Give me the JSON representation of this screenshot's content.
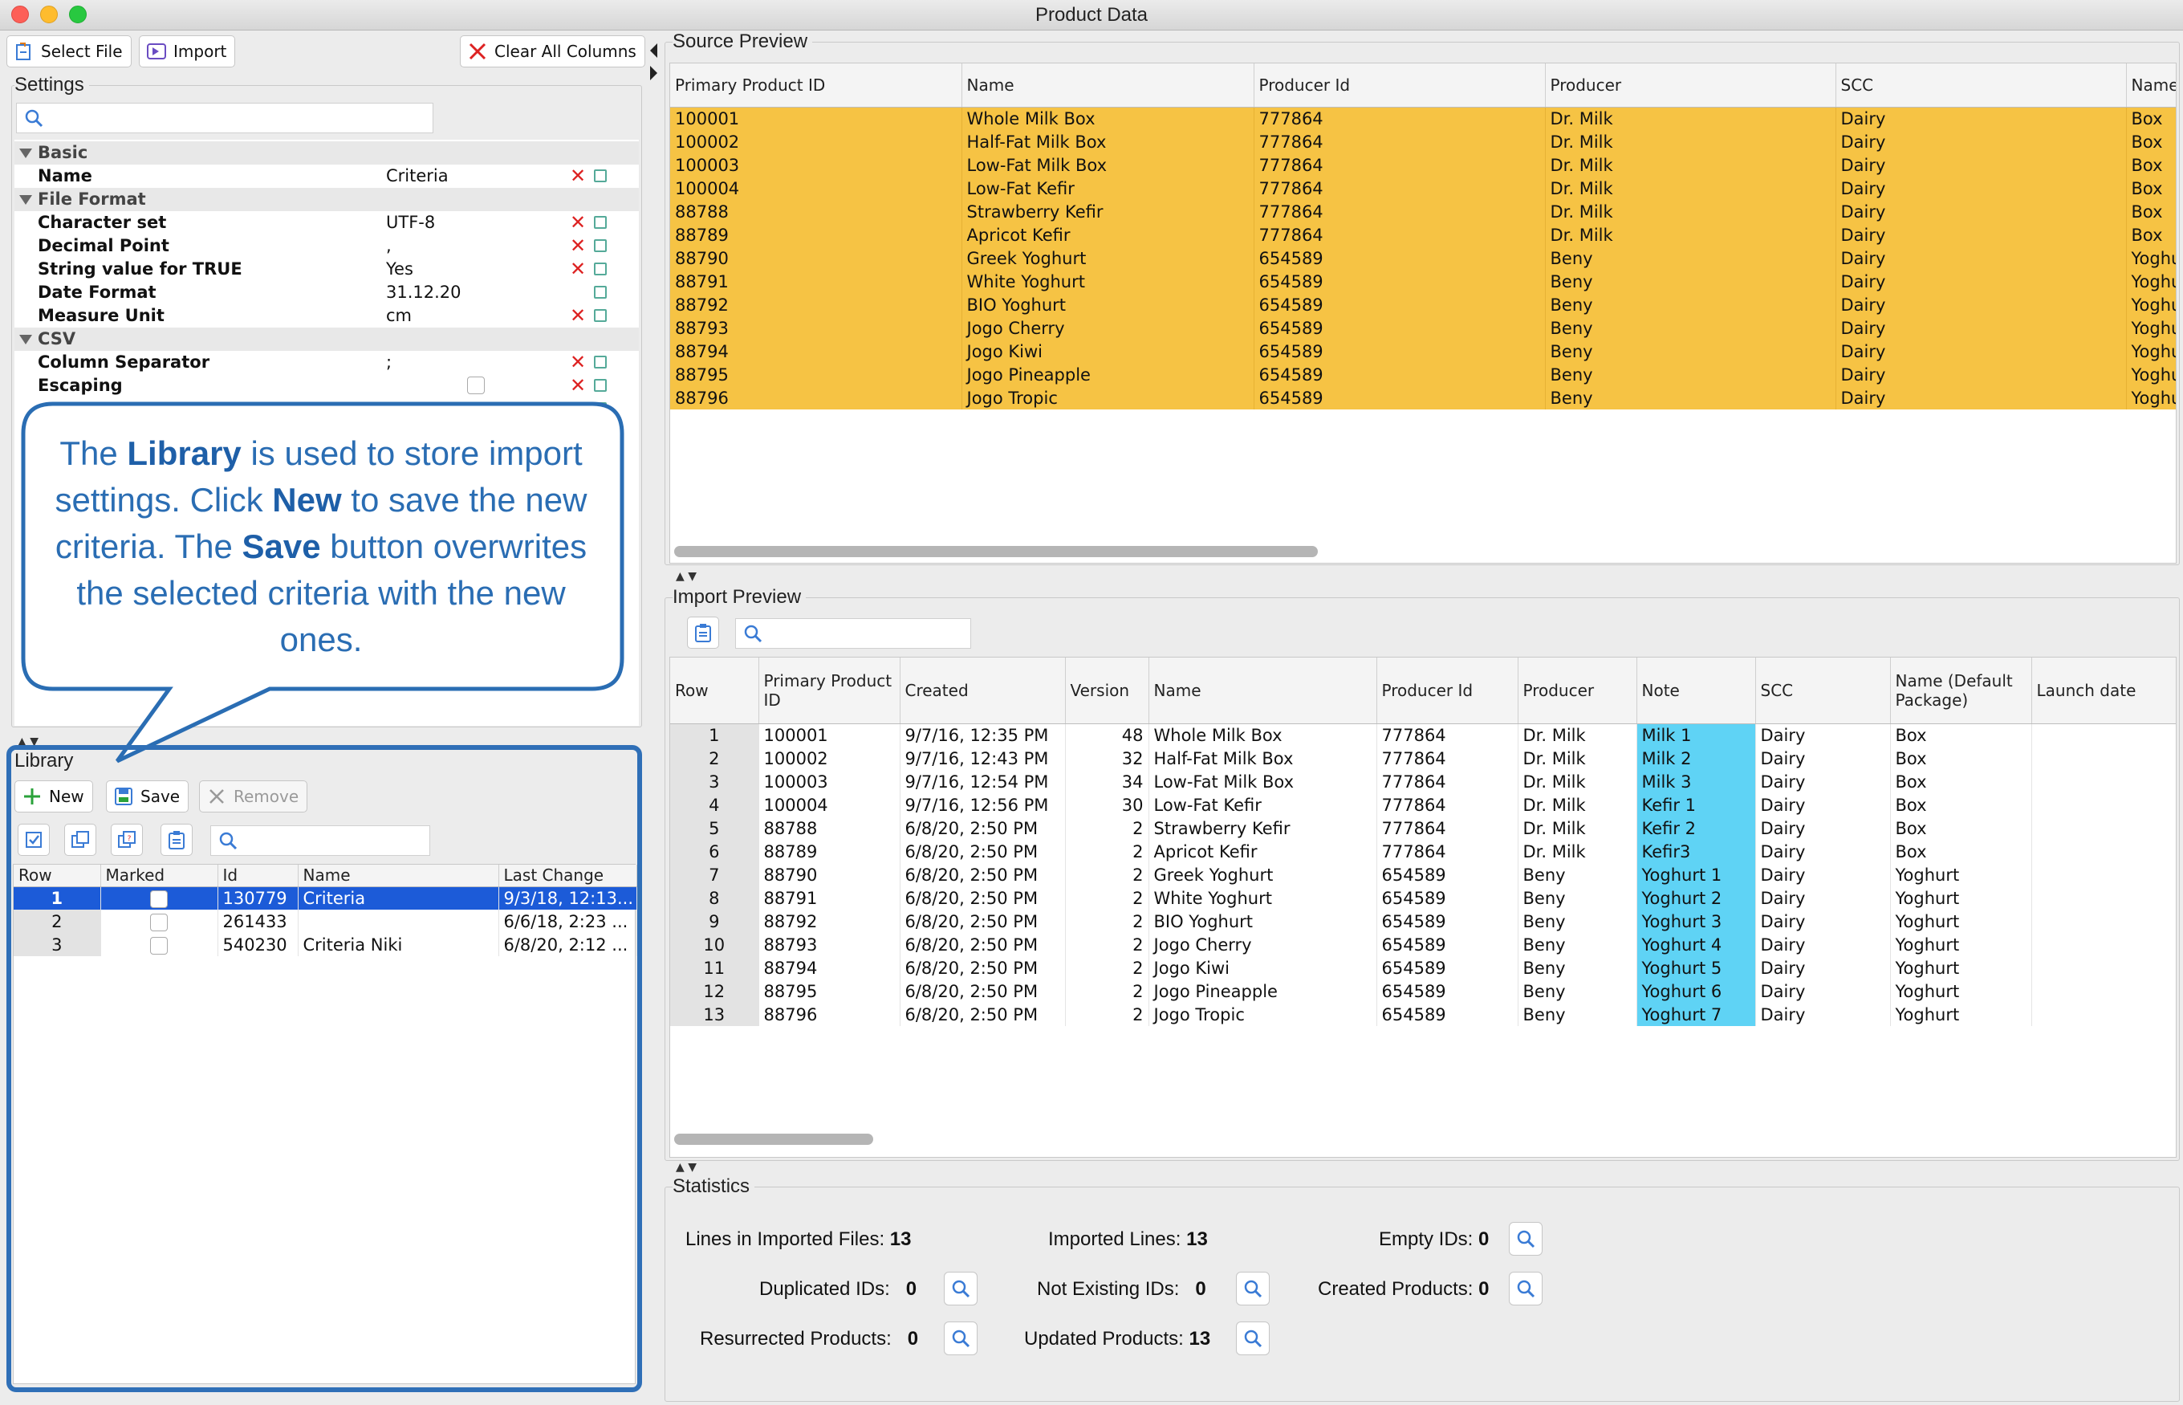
{
  "window": {
    "title": "Product Data"
  },
  "toolbar": {
    "select_file": "Select File",
    "import": "Import",
    "clear_all_columns": "Clear All Columns"
  },
  "settings": {
    "title": "Settings",
    "groups": {
      "basic": "Basic",
      "file_format": "File Format",
      "csv": "CSV"
    },
    "rows": {
      "name": {
        "label": "Name",
        "value": "Criteria"
      },
      "charset": {
        "label": "Character set",
        "value": "UTF-8"
      },
      "decimal": {
        "label": "Decimal Point",
        "value": ","
      },
      "true_string": {
        "label": "String value for TRUE",
        "value": "Yes"
      },
      "date_format": {
        "label": "Date Format",
        "value": "31.12.20"
      },
      "measure_unit": {
        "label": "Measure Unit",
        "value": "cm"
      },
      "col_sep": {
        "label": "Column Separator",
        "value": ";"
      },
      "escaping": {
        "label": "Escaping",
        "value": ""
      }
    }
  },
  "callout": {
    "p1": "The ",
    "b1": "Library",
    "p2": " is used to store import settings. Click ",
    "b2": "New",
    "p3": " to save the new criteria. The ",
    "b3": "Save",
    "p4": " button overwrites the selected criteria with the new ones."
  },
  "library": {
    "title": "Library",
    "buttons": {
      "new": "New",
      "save": "Save",
      "remove": "Remove"
    },
    "columns": [
      "Row",
      "Marked",
      "Id",
      "Name",
      "Last Change"
    ],
    "rows": [
      {
        "row": "1",
        "id": "130779",
        "name": "Criteria",
        "last_change": "9/3/18, 12:13..."
      },
      {
        "row": "2",
        "id": "261433",
        "name": "",
        "last_change": "6/6/18, 2:23 ..."
      },
      {
        "row": "3",
        "id": "540230",
        "name": "Criteria Niki",
        "last_change": "6/8/20, 2:12 ..."
      }
    ]
  },
  "source_preview": {
    "title": "Source Preview",
    "columns": [
      "Primary Product ID",
      "Name",
      "Producer Id",
      "Producer",
      "SCC",
      "Name"
    ],
    "rows": [
      [
        "100001",
        "Whole Milk Box",
        "777864",
        "Dr. Milk",
        "Dairy",
        "Box"
      ],
      [
        "100002",
        "Half-Fat Milk Box",
        "777864",
        "Dr. Milk",
        "Dairy",
        "Box"
      ],
      [
        "100003",
        "Low-Fat Milk Box",
        "777864",
        "Dr. Milk",
        "Dairy",
        "Box"
      ],
      [
        "100004",
        "Low-Fat Kefir",
        "777864",
        "Dr. Milk",
        "Dairy",
        "Box"
      ],
      [
        "88788",
        "Strawberry Kefir",
        "777864",
        "Dr. Milk",
        "Dairy",
        "Box"
      ],
      [
        "88789",
        "Apricot Kefir",
        "777864",
        "Dr. Milk",
        "Dairy",
        "Box"
      ],
      [
        "88790",
        "Greek Yoghurt",
        "654589",
        "Beny",
        "Dairy",
        "Yoghu"
      ],
      [
        "88791",
        "White Yoghurt",
        "654589",
        "Beny",
        "Dairy",
        "Yoghu"
      ],
      [
        "88792",
        "BIO Yoghurt",
        "654589",
        "Beny",
        "Dairy",
        "Yoghu"
      ],
      [
        "88793",
        "Jogo Cherry",
        "654589",
        "Beny",
        "Dairy",
        "Yoghu"
      ],
      [
        "88794",
        "Jogo Kiwi",
        "654589",
        "Beny",
        "Dairy",
        "Yoghu"
      ],
      [
        "88795",
        "Jogo Pineapple",
        "654589",
        "Beny",
        "Dairy",
        "Yoghu"
      ],
      [
        "88796",
        "Jogo Tropic",
        "654589",
        "Beny",
        "Dairy",
        "Yoghu"
      ]
    ]
  },
  "import_preview": {
    "title": "Import Preview",
    "columns": [
      "Row",
      "Primary Product ID",
      "Created",
      "Version",
      "Name",
      "Producer Id",
      "Producer",
      "Note",
      "SCC",
      "Name (Default Package)",
      "Launch date"
    ],
    "rows": [
      [
        "1",
        "100001",
        "9/7/16, 12:35 PM",
        "48",
        "Whole Milk Box",
        "777864",
        "Dr. Milk",
        "Milk 1",
        "Dairy",
        "Box",
        ""
      ],
      [
        "2",
        "100002",
        "9/7/16, 12:43 PM",
        "32",
        "Half-Fat Milk Box",
        "777864",
        "Dr. Milk",
        "Milk 2",
        "Dairy",
        "Box",
        ""
      ],
      [
        "3",
        "100003",
        "9/7/16, 12:54 PM",
        "34",
        "Low-Fat Milk Box",
        "777864",
        "Dr. Milk",
        "Milk 3",
        "Dairy",
        "Box",
        ""
      ],
      [
        "4",
        "100004",
        "9/7/16, 12:56 PM",
        "30",
        "Low-Fat Kefir",
        "777864",
        "Dr. Milk",
        "Kefir 1",
        "Dairy",
        "Box",
        ""
      ],
      [
        "5",
        "88788",
        "6/8/20, 2:50 PM",
        "2",
        "Strawberry Kefir",
        "777864",
        "Dr. Milk",
        "Kefir 2",
        "Dairy",
        "Box",
        ""
      ],
      [
        "6",
        "88789",
        "6/8/20, 2:50 PM",
        "2",
        "Apricot Kefir",
        "777864",
        "Dr. Milk",
        "Kefir3",
        "Dairy",
        "Box",
        ""
      ],
      [
        "7",
        "88790",
        "6/8/20, 2:50 PM",
        "2",
        "Greek Yoghurt",
        "654589",
        "Beny",
        "Yoghurt 1",
        "Dairy",
        "Yoghurt",
        ""
      ],
      [
        "8",
        "88791",
        "6/8/20, 2:50 PM",
        "2",
        "White Yoghurt",
        "654589",
        "Beny",
        "Yoghurt 2",
        "Dairy",
        "Yoghurt",
        ""
      ],
      [
        "9",
        "88792",
        "6/8/20, 2:50 PM",
        "2",
        "BIO Yoghurt",
        "654589",
        "Beny",
        "Yoghurt 3",
        "Dairy",
        "Yoghurt",
        ""
      ],
      [
        "10",
        "88793",
        "6/8/20, 2:50 PM",
        "2",
        "Jogo Cherry",
        "654589",
        "Beny",
        "Yoghurt 4",
        "Dairy",
        "Yoghurt",
        ""
      ],
      [
        "11",
        "88794",
        "6/8/20, 2:50 PM",
        "2",
        "Jogo Kiwi",
        "654589",
        "Beny",
        "Yoghurt 5",
        "Dairy",
        "Yoghurt",
        ""
      ],
      [
        "12",
        "88795",
        "6/8/20, 2:50 PM",
        "2",
        "Jogo Pineapple",
        "654589",
        "Beny",
        "Yoghurt 6",
        "Dairy",
        "Yoghurt",
        ""
      ],
      [
        "13",
        "88796",
        "6/8/20, 2:50 PM",
        "2",
        "Jogo Tropic",
        "654589",
        "Beny",
        "Yoghurt 7",
        "Dairy",
        "Yoghurt",
        ""
      ]
    ]
  },
  "statistics": {
    "title": "Statistics",
    "lines_in_files": {
      "label": "Lines in Imported Files:",
      "value": "13"
    },
    "imported_lines": {
      "label": "Imported Lines:",
      "value": "13"
    },
    "empty_ids": {
      "label": "Empty IDs:",
      "value": "0"
    },
    "duplicated_ids": {
      "label": "Duplicated IDs:",
      "value": "0"
    },
    "not_existing_ids": {
      "label": "Not Existing IDs:",
      "value": "0"
    },
    "created_products": {
      "label": "Created Products:",
      "value": "0"
    },
    "resurrected_products": {
      "label": "Resurrected Products:",
      "value": "0"
    },
    "updated_products": {
      "label": "Updated Products:",
      "value": "13"
    }
  },
  "colors": {
    "source_row": "#f6c344",
    "note_cell": "#5fd3f5",
    "selection": "#1c5bd8",
    "callout_border": "#2a6db3",
    "library_border": "#2f6fb7"
  },
  "icons": [
    "search-icon",
    "close-icon",
    "add-icon",
    "save-icon",
    "import-icon",
    "select-file-icon",
    "magnifier-icon",
    "copy-icon",
    "check-all-icon"
  ]
}
